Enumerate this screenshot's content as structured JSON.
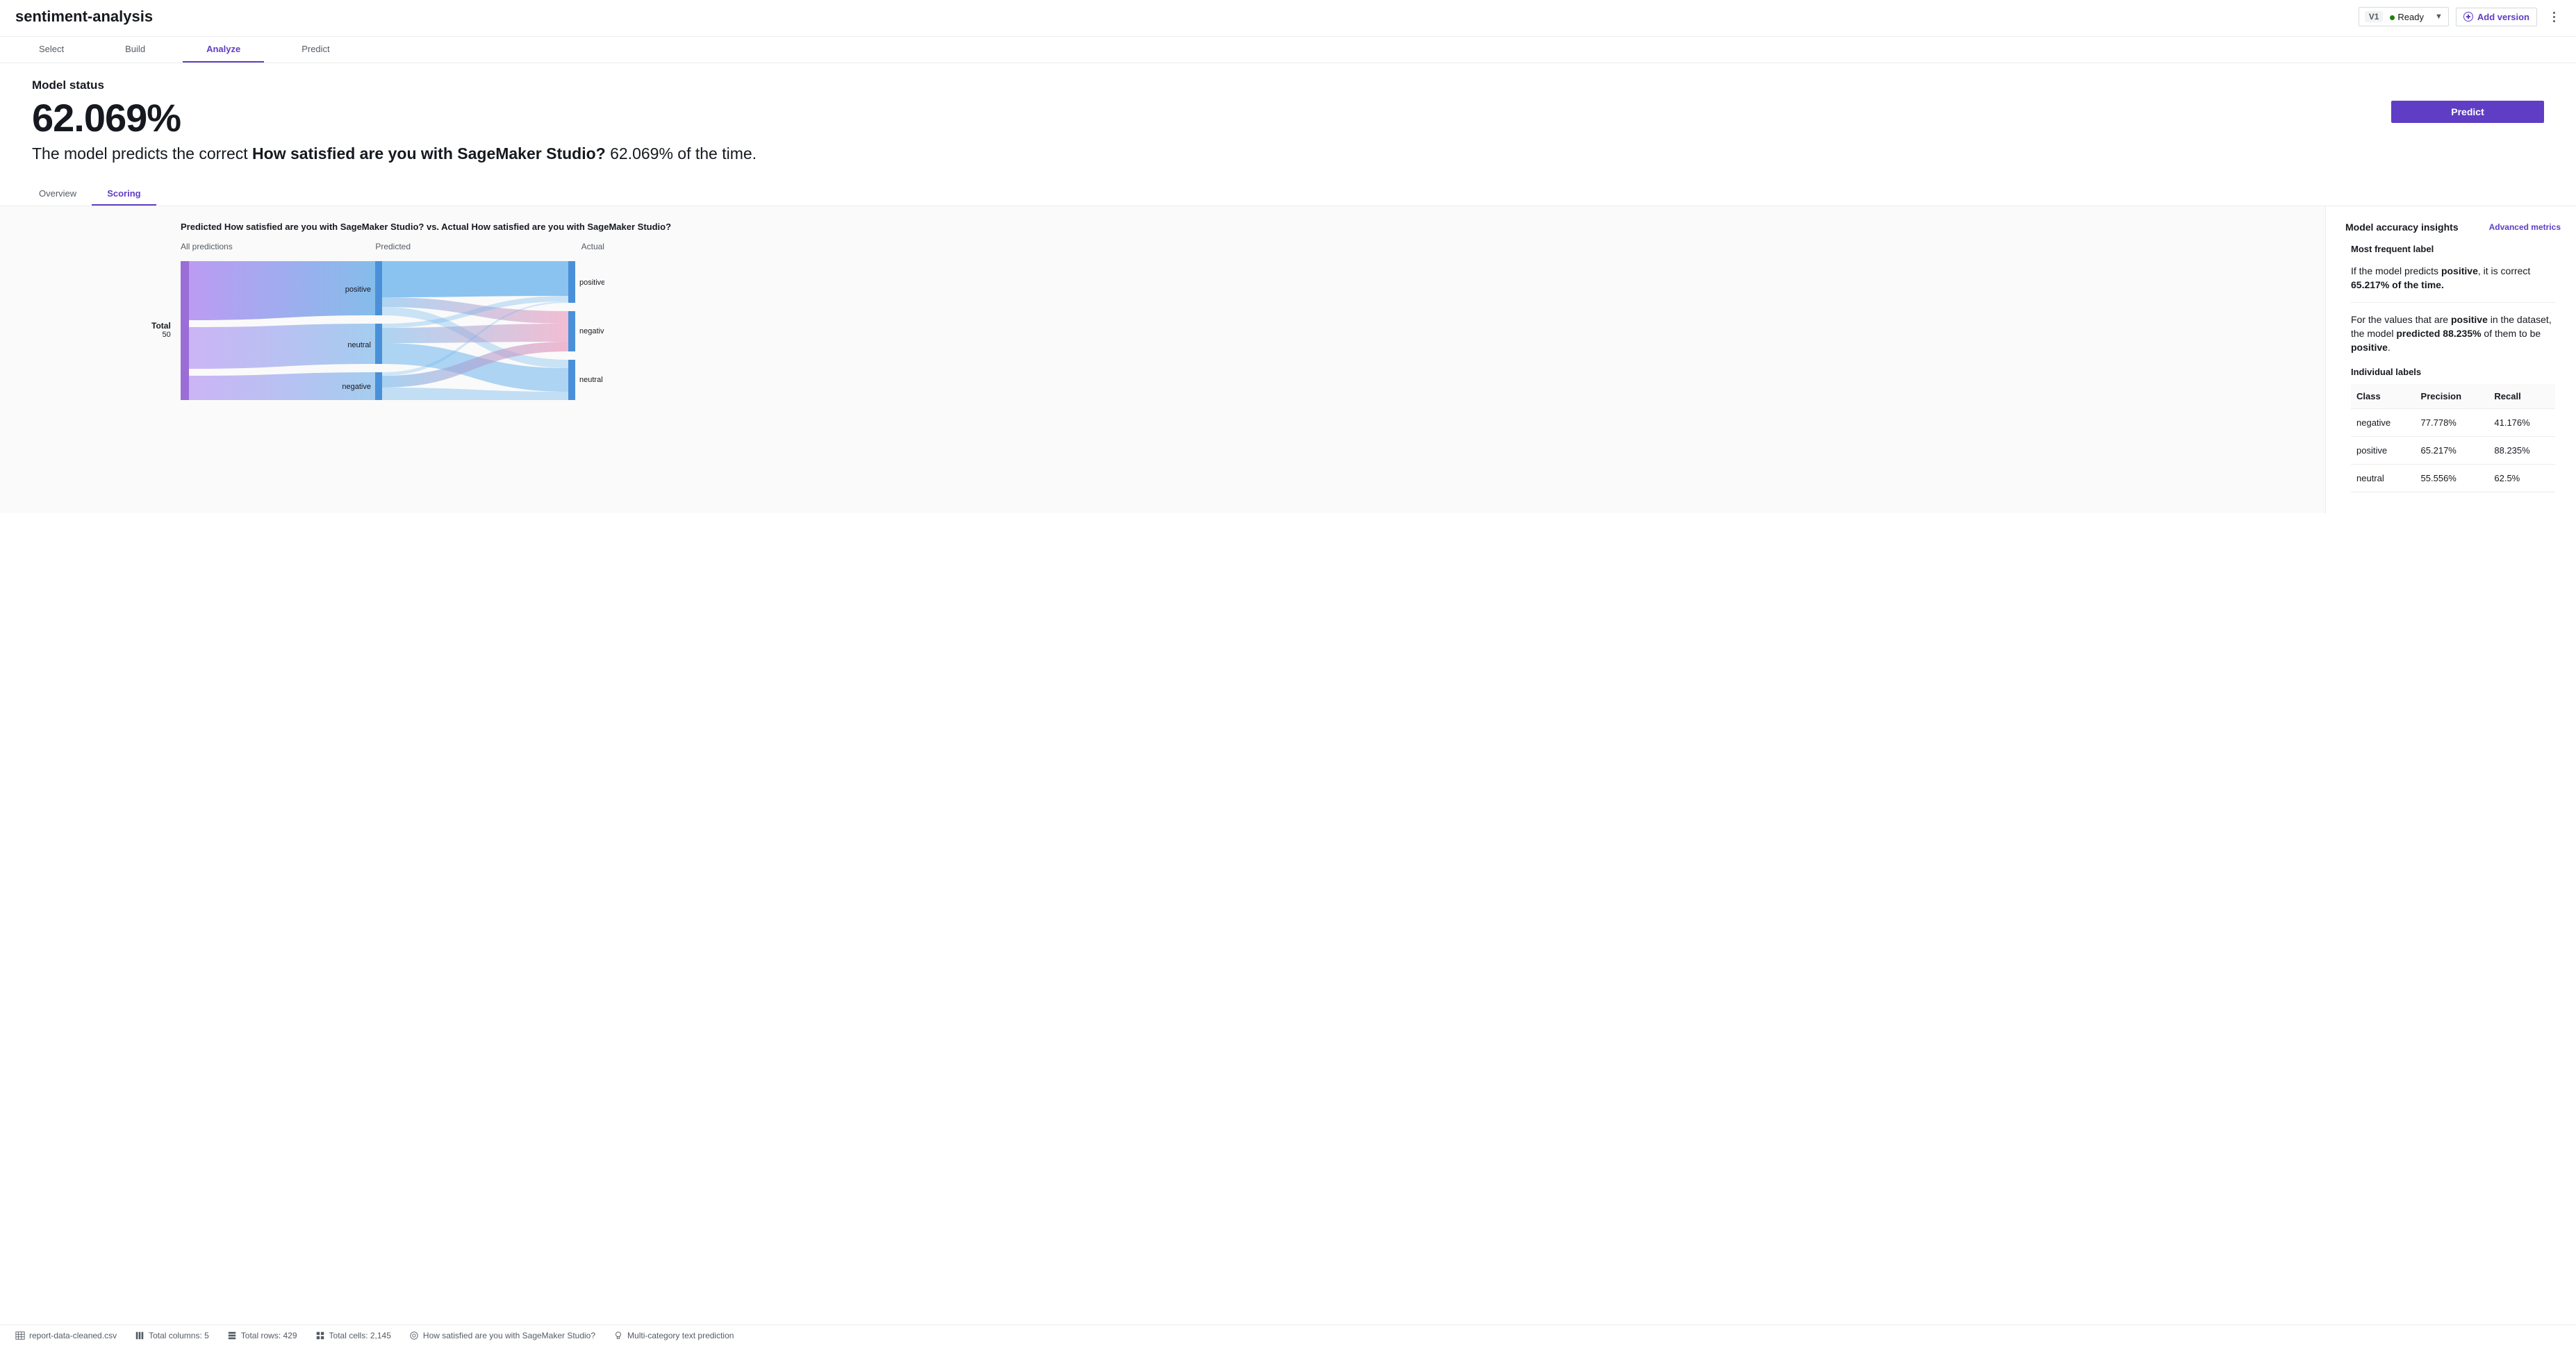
{
  "header": {
    "title": "sentiment-analysis",
    "version_label": "V1",
    "ready_label": "Ready",
    "add_version_label": "Add version"
  },
  "tabs": [
    "Select",
    "Build",
    "Analyze",
    "Predict"
  ],
  "active_tab_index": 2,
  "model_status": {
    "heading": "Model status",
    "accuracy_pct": "62.069%",
    "predict_button": "Predict",
    "description_prefix": "The model predicts the correct ",
    "description_bold": "How satisfied are you with SageMaker Studio?",
    "description_suffix": " 62.069% of the time."
  },
  "subtabs": [
    "Overview",
    "Scoring"
  ],
  "active_subtab_index": 1,
  "sankey": {
    "title": "Predicted How satisfied are you with SageMaker Studio? vs. Actual How satisfied are you with SageMaker Studio?",
    "col_all": "All predictions",
    "col_predicted": "Predicted",
    "col_actual": "Actual",
    "total_label": "Total",
    "total_value": "50",
    "predicted_labels": [
      "positive",
      "neutral",
      "negative"
    ],
    "actual_labels": [
      "positive",
      "negative",
      "neutral"
    ]
  },
  "insights": {
    "heading": "Model accuracy insights",
    "advanced_link": "Advanced metrics",
    "mfl_heading": "Most frequent label",
    "p1_a": "If the model predicts ",
    "p1_b": "positive",
    "p1_c": ", it is correct ",
    "p1_d": "65.217% of the time.",
    "p2_a": "For the values that are ",
    "p2_b": "positive",
    "p2_c": " in the dataset, the model ",
    "p2_d": "predicted 88.235%",
    "p2_e": " of them to be ",
    "p2_f": "positive",
    "p2_g": ".",
    "indiv_heading": "Individual labels",
    "table_headers": [
      "Class",
      "Precision",
      "Recall"
    ],
    "rows": [
      {
        "class": "negative",
        "precision": "77.778%",
        "recall": "41.176%"
      },
      {
        "class": "positive",
        "precision": "65.217%",
        "recall": "88.235%"
      },
      {
        "class": "neutral",
        "precision": "55.556%",
        "recall": "62.5%"
      }
    ]
  },
  "footer": {
    "file": "report-data-cleaned.csv",
    "cols": "Total columns: 5",
    "rows": "Total rows: 429",
    "cells": "Total cells: 2,145",
    "target": "How satisfied are you with SageMaker Studio?",
    "type": "Multi-category text prediction"
  },
  "chart_data": {
    "type": "sankey",
    "title": "Predicted How satisfied are you with SageMaker Studio? vs. Actual How satisfied are you with SageMaker Studio?",
    "total": 50,
    "predicted_counts": {
      "positive": 23,
      "neutral": 18,
      "negative": 9
    },
    "actual_counts": {
      "positive": 17,
      "negative": 17,
      "neutral": 16
    },
    "flows_predicted_to_actual": [
      {
        "from": "positive",
        "to": "positive",
        "value": 15
      },
      {
        "from": "positive",
        "to": "negative",
        "value": 5
      },
      {
        "from": "positive",
        "to": "neutral",
        "value": 3
      },
      {
        "from": "neutral",
        "to": "positive",
        "value": 1
      },
      {
        "from": "neutral",
        "to": "negative",
        "value": 7
      },
      {
        "from": "neutral",
        "to": "neutral",
        "value": 10
      },
      {
        "from": "negative",
        "to": "positive",
        "value": 1
      },
      {
        "from": "negative",
        "to": "negative",
        "value": 5
      },
      {
        "from": "negative",
        "to": "neutral",
        "value": 3
      }
    ]
  }
}
